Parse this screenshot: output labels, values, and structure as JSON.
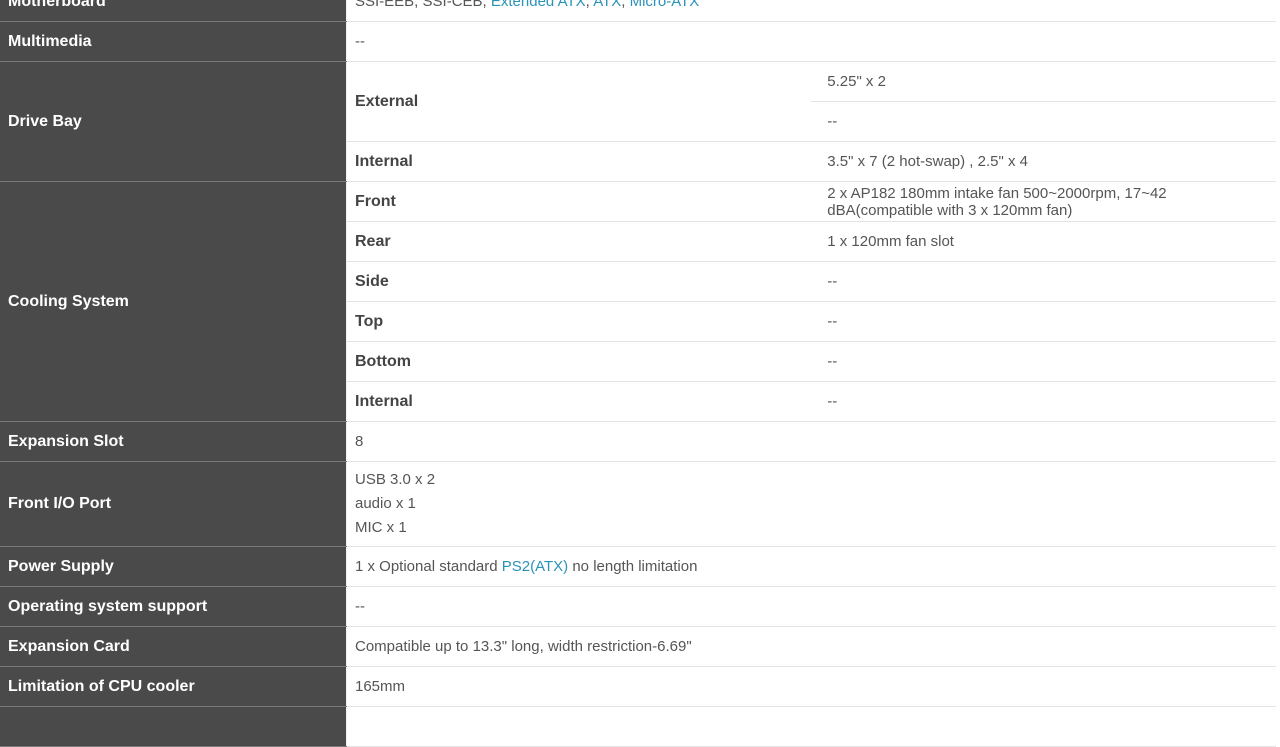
{
  "rows": {
    "motherboard": {
      "label": "Motherboard",
      "value_prefix": "SSI-EEB, SSI-CEB, ",
      "links": [
        "Extended ATX",
        "ATX",
        "Micro-ATX"
      ],
      "sep": ", "
    },
    "multimedia": {
      "label": "Multimedia",
      "value": "--"
    },
    "drive_bay": {
      "label": "Drive Bay",
      "external_label": "External",
      "external_values": [
        "5.25\" x 2",
        "--"
      ],
      "internal_label": "Internal",
      "internal_value": "3.5\" x 7 (2 hot-swap) , 2.5\" x 4"
    },
    "cooling": {
      "label": "Cooling System",
      "items": [
        {
          "label": "Front",
          "value": "2 x AP182 180mm intake fan 500~2000rpm, 17~42 dBA(compatible with 3 x 120mm fan)"
        },
        {
          "label": "Rear",
          "value": "1 x 120mm fan slot"
        },
        {
          "label": "Side",
          "value": "--"
        },
        {
          "label": "Top",
          "value": "--"
        },
        {
          "label": "Bottom",
          "value": "--"
        },
        {
          "label": "Internal",
          "value": "--"
        }
      ]
    },
    "expansion_slot": {
      "label": "Expansion Slot",
      "value": "8"
    },
    "front_io": {
      "label": "Front I/O Port",
      "lines": [
        "USB 3.0 x 2",
        "audio x 1",
        "MIC x 1"
      ]
    },
    "power_supply": {
      "label": "Power Supply",
      "value_prefix": "1 x Optional standard ",
      "link": "PS2(ATX)",
      "value_suffix": " no length limitation"
    },
    "os_support": {
      "label": "Operating system support",
      "value": "--"
    },
    "expansion_card": {
      "label": "Expansion Card",
      "value": "Compatible up to 13.3\" long, width restriction-6.69\""
    },
    "cpu_cooler": {
      "label": "Limitation of CPU cooler",
      "value": "165mm"
    }
  },
  "colors": {
    "category_bg": "#4a4a4a",
    "link": "#2a93b8",
    "text": "#555555"
  }
}
